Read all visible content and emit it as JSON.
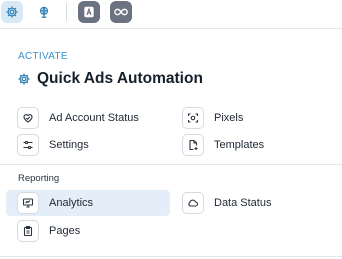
{
  "topbar": {
    "buttons": [
      {
        "icon": "gear-icon",
        "active": true
      },
      {
        "icon": "globe-icon",
        "active": false
      },
      {
        "icon": "app-a-icon",
        "active": false
      },
      {
        "icon": "infinity-icon",
        "active": false
      }
    ]
  },
  "header": {
    "section_label": "ACTIVATE",
    "title": "Quick Ads Automation",
    "title_icon": "gear-icon"
  },
  "menu": {
    "items": [
      {
        "label": "Ad Account Status",
        "icon": "heart-check-icon"
      },
      {
        "label": "Pixels",
        "icon": "pixel-scan-icon"
      },
      {
        "label": "Settings",
        "icon": "sliders-icon"
      },
      {
        "label": "Templates",
        "icon": "document-add-icon"
      }
    ]
  },
  "reporting": {
    "heading": "Reporting",
    "items": [
      {
        "label": "Analytics",
        "icon": "monitor-chart-icon",
        "selected": true
      },
      {
        "label": "Data Status",
        "icon": "cloud-sync-icon",
        "selected": false
      },
      {
        "label": "Pages",
        "icon": "clipboard-icon",
        "selected": false
      }
    ]
  },
  "colors": {
    "accent": "#3a93c4",
    "selected_bg": "#e3eef8",
    "active_button_bg": "#d7e8f6",
    "text": "#1f2733"
  }
}
